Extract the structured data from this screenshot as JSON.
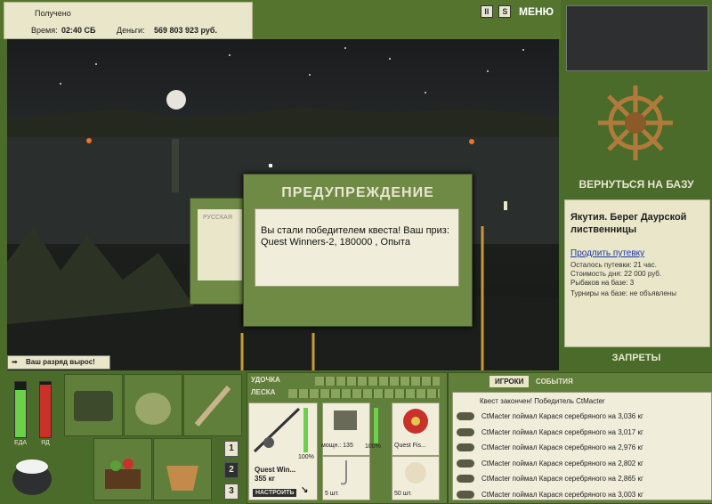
{
  "info": {
    "received_label": "Получено",
    "time_label": "Время:",
    "time_value": "02:40 СБ",
    "money_label": "Деньги:",
    "money_value": "569 803 923 руб."
  },
  "top": {
    "pause_label": "II",
    "sound_label": "S",
    "menu_label": "МЕНЮ"
  },
  "dialog": {
    "title": "ПРЕДУПРЕЖДЕНИЕ",
    "message_line1": "Вы стали победителем квеста! Ваш приз:",
    "message_line2": "Quest Winners-2, 180000 , Опыта"
  },
  "behind_dialog": {
    "label": "РУССКАЯ"
  },
  "notice": {
    "rank_up": "Ваш разряд вырос!"
  },
  "right_panel": {
    "return_label": "ВЕРНУТЬСЯ НА БАЗУ",
    "location": "Якутия. Берег Даурской лиственницы",
    "extend_link": "Продлить путевку",
    "trip_left": "Осталось путевки: 21 час.",
    "day_cost": "Стоимость дня: 22 000 руб.",
    "fishers": "Рыбаков на базе: 3",
    "tournaments": "Турниры на базе: не объявлены",
    "bans_label": "ЗАПРЕТЫ"
  },
  "status": {
    "food_label": "ЕДА",
    "poison_label": "ЯД",
    "food_level": 0.85,
    "poison_level": 0.95
  },
  "bag_buttons": [
    "1",
    "2",
    "3"
  ],
  "rod_panel": {
    "rod_label": "УДОЧКА",
    "line_label": "ЛЕСКА",
    "rod_name": "Quest Win...",
    "rod_weight": "355 кг",
    "rod_percent": "100%",
    "setup_label": "НАСТРОИТЬ",
    "reel_label": "мощн.: 135",
    "reel_percent": "100%",
    "line_name": "Quest Fis...",
    "hook_count": "5 шт.",
    "bait_count": "50 шт."
  },
  "chat": {
    "tab_players": "ИГРОКИ",
    "tab_events": "СОБЫТИЯ",
    "quest_done": "Квест закончен! Победитель CtMacter",
    "lines": [
      "CtMacter поймал Карася серебряного на 3,036 кг",
      "CtMacter поймал Карася серебряного на 3,017 кг",
      "CtMacter поймал Карася серебряного на 2,976 кг",
      "CtMacter поймал Карася серебряного на 2,802 кг",
      "CtMacter поймал Карася серебряного на 2,865 кг",
      "CtMacter поймал Карася серебряного на 3,003 кг"
    ]
  },
  "colors": {
    "panel_green": "#4a6b2a",
    "cream": "#e9e6c9",
    "gauge_green": "#6cd04a",
    "gauge_red": "#c8322a"
  }
}
